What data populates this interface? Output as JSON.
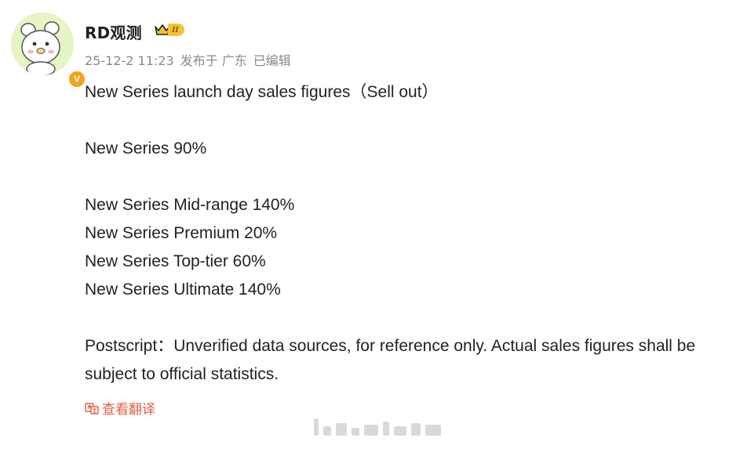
{
  "user": {
    "name": "RD观测",
    "level": "II",
    "verified_mark": "V",
    "icons": [
      "avatar-bear-illustration",
      "crown-icon",
      "verified-badge-icon"
    ]
  },
  "meta": {
    "timestamp": "25-12-2 11:23",
    "location": "发布于 广东",
    "edited": "已编辑"
  },
  "post": {
    "line1": "New Series launch day sales figures（Sell out）",
    "line2": "New Series 90%",
    "line3": "New Series Mid-range 140%",
    "line4": "New Series Premium 20%",
    "line5": "New Series Top-tier 60%",
    "line6": "New Series Ultimate 140%",
    "line7": "Postscript：Unverified data sources, for reference only. Actual sales figures shall be subject to official statistics."
  },
  "actions": {
    "translate_label": "查看翻译",
    "translate_icon": "translate-icon"
  },
  "colors": {
    "accent": "#e35d3d",
    "meta_gray": "#8a8a8a",
    "badge_orange": "#f7a21d"
  }
}
